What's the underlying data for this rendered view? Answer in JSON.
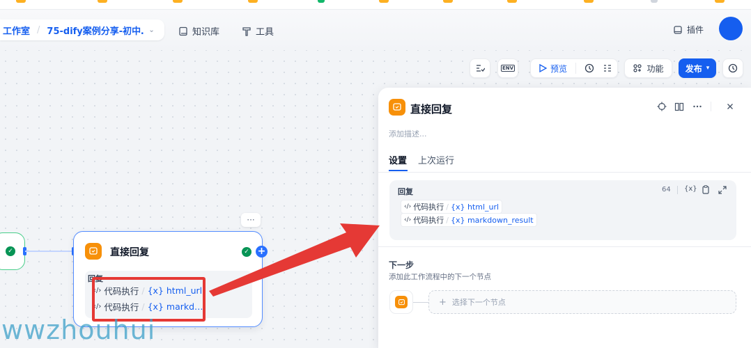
{
  "colors": {
    "accent": "#155eef",
    "node_icon": "#f79009",
    "success": "#079455",
    "annotation_red": "#e53935"
  },
  "breadcrumb": {
    "studio": "工作室",
    "app_name": "75-dify案例分享-初中…"
  },
  "nav": {
    "knowledge": "知识库",
    "tools": "工具"
  },
  "header_right": {
    "plugins": "插件"
  },
  "toolbar": {
    "preview": "预览",
    "features": "功能",
    "publish": "发布",
    "env_label": "ENV"
  },
  "canvas_node": {
    "title": "直接回复",
    "body_label": "回复",
    "rows": [
      {
        "source": "代码执行",
        "var": "{x} html_url"
      },
      {
        "source": "代码执行",
        "var": "{x} markd…"
      }
    ],
    "more": "···"
  },
  "panel": {
    "title": "直接回复",
    "description_placeholder": "添加描述...",
    "tabs": [
      "设置",
      "上次运行"
    ],
    "reply_label": "回复",
    "char_count": "64",
    "var_button": "{x}",
    "rows": [
      {
        "source": "代码执行",
        "var": "{x} html_url"
      },
      {
        "source": "代码执行",
        "var": "{x} markdown_result"
      }
    ],
    "next_step_title": "下一步",
    "next_step_desc": "添加此工作流程中的下一个节点",
    "select_next": "选择下一个节点"
  },
  "watermark": "wwzhouhui"
}
